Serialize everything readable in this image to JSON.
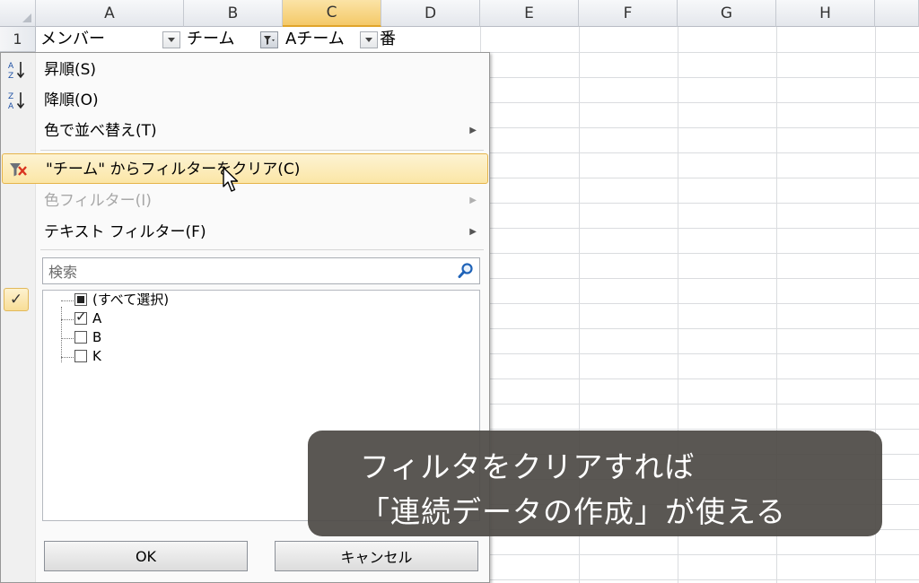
{
  "sheet": {
    "columns": [
      {
        "label": "A",
        "selected": false
      },
      {
        "label": "B",
        "selected": false
      },
      {
        "label": "C",
        "selected": true
      },
      {
        "label": "D",
        "selected": false
      },
      {
        "label": "E",
        "selected": false
      },
      {
        "label": "F",
        "selected": false
      },
      {
        "label": "G",
        "selected": false
      },
      {
        "label": "H",
        "selected": false
      }
    ],
    "row1": {
      "number": "1",
      "a": "メンバー",
      "b": "チーム",
      "c": "Aチーム",
      "d": "番"
    },
    "selected_column_color": "#f4c968"
  },
  "menu": {
    "sort_asc": "昇順(S)",
    "sort_desc": "降順(O)",
    "sort_by_color": "色で並べ替え(T)",
    "clear_filter": "\"チーム\" からフィルターをクリア(C)",
    "color_filter": "色フィルター(I)",
    "text_filter": "テキスト フィルター(F)",
    "search_placeholder": "検索",
    "hover_color": "#fbe6a6"
  },
  "list": {
    "items": [
      {
        "label": "(すべて選択)",
        "state": "partial"
      },
      {
        "label": "A",
        "state": "checked"
      },
      {
        "label": "B",
        "state": "unchecked"
      },
      {
        "label": "K",
        "state": "unchecked"
      }
    ]
  },
  "buttons": {
    "ok": "OK",
    "cancel": "キャンセル"
  },
  "caption": {
    "line1": "フィルタをクリアすれば",
    "line2": "「連続データの作成」が使える"
  }
}
